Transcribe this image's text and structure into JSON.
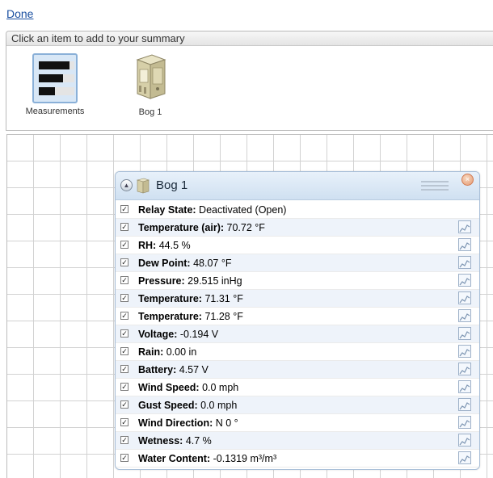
{
  "top": {
    "done_label": "Done"
  },
  "palette": {
    "header": "Click an item to add to your summary",
    "items": [
      {
        "label": "Measurements",
        "icon": "measurements-icon"
      },
      {
        "label": "Bog 1",
        "icon": "device-icon"
      }
    ]
  },
  "panel": {
    "title": "Bog 1",
    "rows": [
      {
        "checked": true,
        "label": "Relay State:",
        "value": "Deactivated (Open)",
        "graph": false
      },
      {
        "checked": true,
        "label": "Temperature (air):",
        "value": "70.72 °F",
        "graph": true
      },
      {
        "checked": true,
        "label": "RH:",
        "value": "44.5 %",
        "graph": true
      },
      {
        "checked": true,
        "label": "Dew Point:",
        "value": "48.07 °F",
        "graph": true
      },
      {
        "checked": true,
        "label": "Pressure:",
        "value": "29.515 inHg",
        "graph": true
      },
      {
        "checked": true,
        "label": "Temperature:",
        "value": "71.31 °F",
        "graph": true
      },
      {
        "checked": true,
        "label": "Temperature:",
        "value": "71.28 °F",
        "graph": true
      },
      {
        "checked": true,
        "label": "Voltage:",
        "value": "-0.194 V",
        "graph": true
      },
      {
        "checked": true,
        "label": "Rain:",
        "value": "0.00 in",
        "graph": true
      },
      {
        "checked": true,
        "label": "Battery:",
        "value": "4.57 V",
        "graph": true
      },
      {
        "checked": true,
        "label": "Wind Speed:",
        "value": "0.0 mph",
        "graph": true
      },
      {
        "checked": true,
        "label": "Gust Speed:",
        "value": "0.0 mph",
        "graph": true
      },
      {
        "checked": true,
        "label": "Wind Direction:",
        "value": "N 0 °",
        "graph": true
      },
      {
        "checked": true,
        "label": "Wetness:",
        "value": "4.7 %",
        "graph": true
      },
      {
        "checked": true,
        "label": "Water Content:",
        "value": "-0.1319 m³/m³",
        "graph": true
      }
    ]
  },
  "colors": {
    "link": "#1a4fa0",
    "panel_header": "#dbe8f5",
    "row_alt": "#eef3fa"
  }
}
